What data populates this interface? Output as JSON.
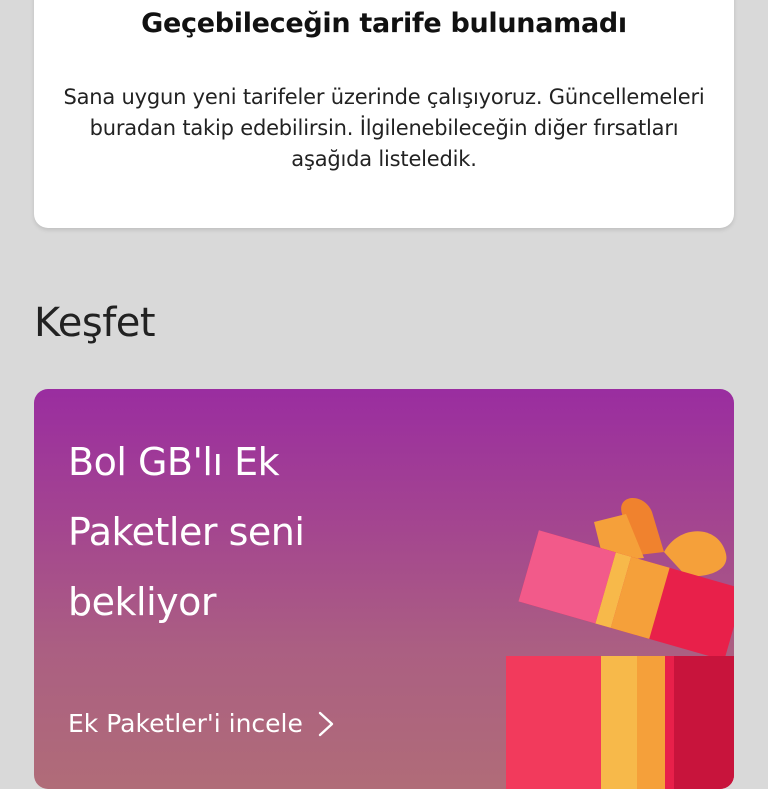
{
  "info_card": {
    "title": "Geçebileceğin tarife bulunamadı",
    "description": "Sana uygun yeni tarifeler üzerinde çalışıyoruz. Güncellemeleri buradan takip edebilirsin. İlgilenebileceğin diğer fırsatları aşağıda listeledik."
  },
  "explore": {
    "title": "Keşfet"
  },
  "promo": {
    "headline": "Bol GB'lı Ek Paketler seni bekliyor",
    "link_label": "Ek Paketler'i incele",
    "link_icon": "chevron-right-icon",
    "illustration": "gift-box-icon"
  },
  "colors": {
    "background": "#d9d9d9",
    "card_background": "#ffffff",
    "promo_gradient_top": "#9a2da0",
    "promo_gradient_bottom": "#b06c78",
    "gift_red": "#e8204a",
    "gift_orange": "#f5a03a",
    "gift_pink": "#f25a8a"
  }
}
